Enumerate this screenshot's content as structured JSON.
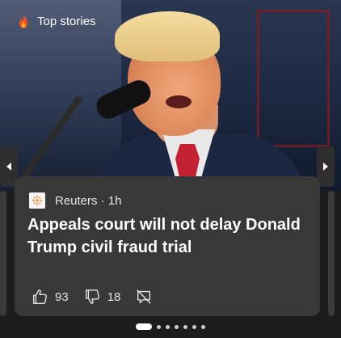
{
  "header": {
    "title": "Top stories",
    "icon": "fire-icon",
    "icon_color": "#f25022"
  },
  "story": {
    "image_alt": "Speaker at a microphone in a suit and red tie",
    "source": "Reuters · 1h",
    "headline": "Appeals court will not delay Donald Trump civil fraud trial",
    "likes": "93",
    "dislikes": "18"
  },
  "pagination": {
    "total_pages": 7,
    "active_index": 0
  },
  "colors": {
    "background": "#1c1c1c",
    "card": "#383838",
    "text": "#ffffff"
  }
}
